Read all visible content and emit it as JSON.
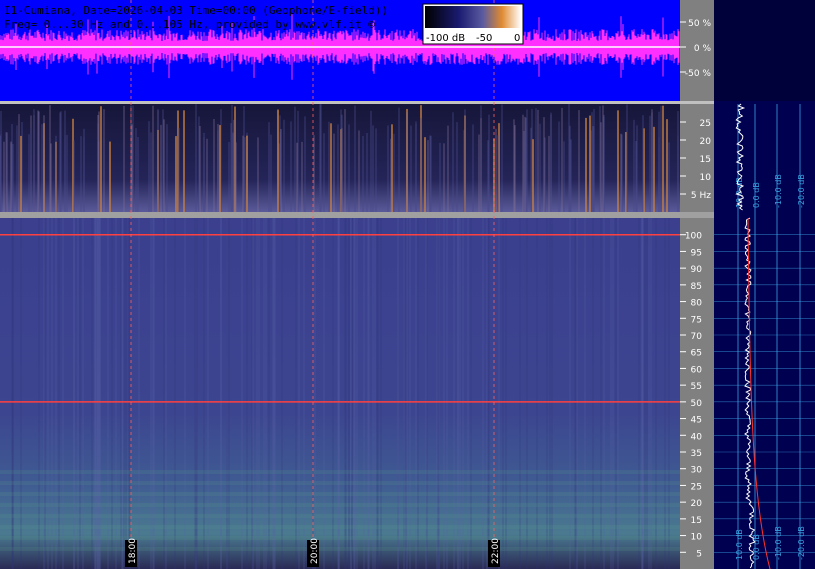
{
  "header": {
    "line1": "I1-Cumiana, Date=2026-04-03 Time=00:00 (Geophone/E-field))",
    "line2": "Freq= 0...30 Hz and 0...105 Hz, provided by www.vlf.it ©"
  },
  "colorbar": {
    "labels": [
      "-100 dB",
      "-50",
      "0"
    ]
  },
  "colors": {
    "waveform_bg": "#0000ff",
    "waveform_trace": "#ff30ff",
    "spectrogram_bg": "#3d3f8f",
    "low_band_bg": "#14142e",
    "axis_panel_bg": "#808080",
    "profile_panel_bg": "#000050",
    "marker_line": "#ff4040"
  },
  "chart_data": [
    {
      "type": "line",
      "panel": "waveform",
      "ylabel_ticks": [
        "50 %",
        "0 %",
        "-50 %"
      ],
      "y": [
        50,
        0,
        -50
      ],
      "ylim": [
        -100,
        100
      ]
    },
    {
      "type": "heatmap",
      "panel": "low-frequency spectrogram",
      "unit_label": "Hz",
      "y_ticks": [
        25,
        20,
        15,
        10,
        5
      ],
      "ylim": [
        0,
        30
      ]
    },
    {
      "type": "heatmap",
      "panel": "main spectrogram",
      "y_ticks": [
        100,
        95,
        90,
        85,
        80,
        75,
        70,
        65,
        60,
        55,
        50,
        45,
        40,
        35,
        30,
        25,
        20,
        15,
        10,
        5
      ],
      "ylim": [
        0,
        105
      ],
      "x_ticks": [
        "18:00",
        "20:00",
        "22:00"
      ],
      "marked_lines_hz": [
        50,
        100
      ]
    },
    {
      "type": "line",
      "panel": "spectrum profile",
      "x_ticks": [
        "10.0 dB",
        "0.0 dB",
        "-10.0 dB",
        "-20.0 dB"
      ]
    }
  ]
}
